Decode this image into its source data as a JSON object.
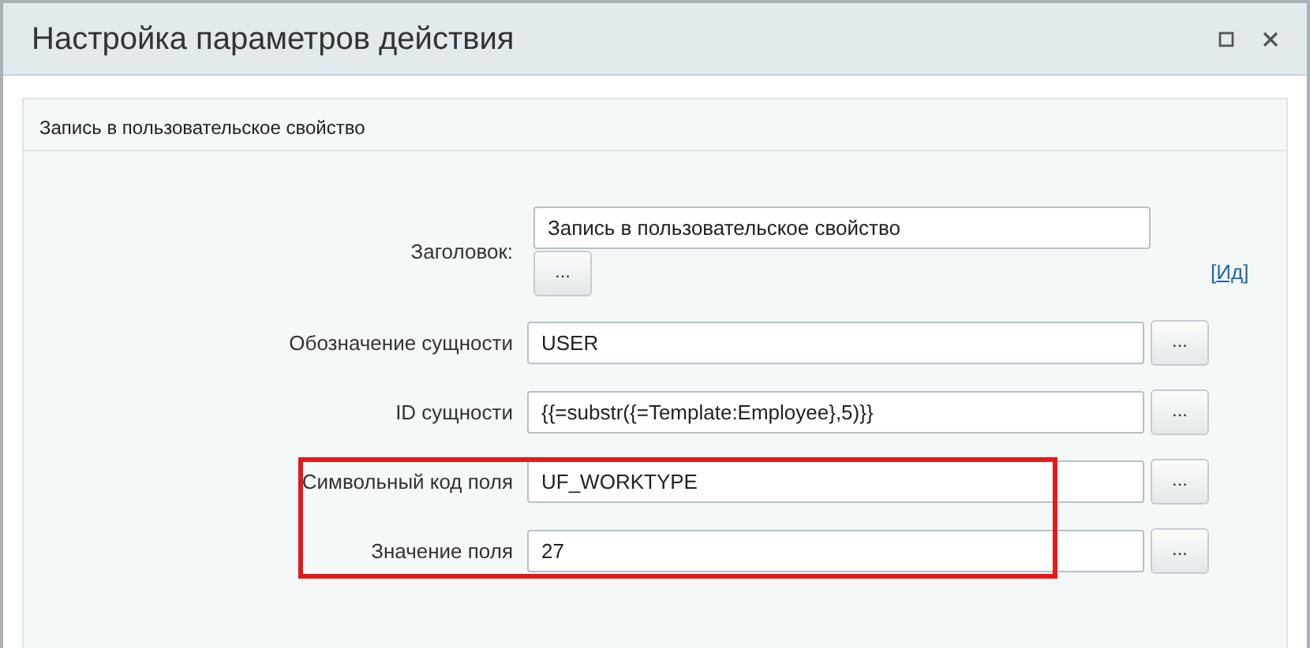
{
  "window": {
    "title": "Настройка параметров действия"
  },
  "panel": {
    "title": "Запись в пользовательское свойство"
  },
  "rows": [
    {
      "kind": "title",
      "label": "Заголовок:",
      "value": "Запись в пользовательское свойство",
      "button": "...",
      "link_open": "[",
      "link": "Ид",
      "link_close": "]",
      "highlighted": false
    },
    {
      "kind": "field",
      "label": "Обозначение сущности",
      "value": "USER",
      "button": "...",
      "highlighted": false
    },
    {
      "kind": "field",
      "label": "ID сущности",
      "value": "{{=substr({=Template:Employee},5)}}",
      "button": "...",
      "highlighted": false
    },
    {
      "kind": "field",
      "label": "Символьный код поля",
      "value": "UF_WORKTYPE",
      "button": "...",
      "highlighted": true
    },
    {
      "kind": "field",
      "label": "Значение поля",
      "value": "27",
      "button": "...",
      "highlighted": true
    }
  ]
}
